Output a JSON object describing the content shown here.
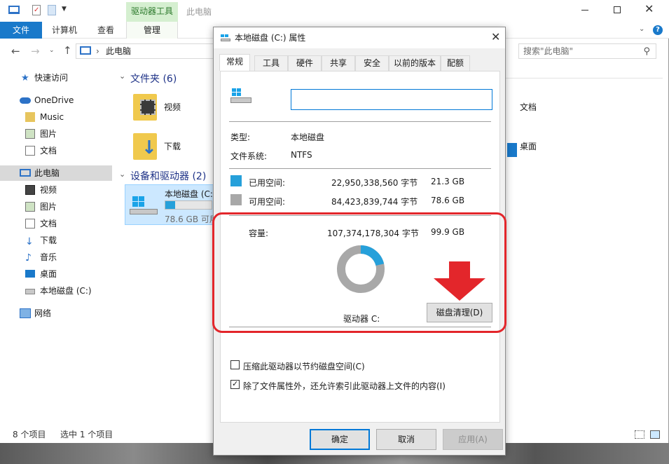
{
  "explorer": {
    "ribbon_tabs": [
      "文件",
      "计算机",
      "查看"
    ],
    "context_group": "驱动器工具",
    "context_tab": "管理",
    "window_title": "此电脑",
    "address": "此电脑",
    "search_placeholder": "搜索\"此电脑\"",
    "nav": {
      "quick_access": "快速访问",
      "onedrive": "OneDrive",
      "music": "Music",
      "pictures": "图片",
      "documents": "文档",
      "this_pc": "此电脑",
      "videos": "视频",
      "pictures2": "图片",
      "documents2": "文档",
      "downloads": "下载",
      "music2": "音乐",
      "desktop": "桌面",
      "local_disk": "本地磁盘 (C:)",
      "network": "网络"
    },
    "folders_header": "文件夹 (6)",
    "devices_header": "设备和驱动器 (2)",
    "folders": {
      "videos": "视频",
      "downloads": "下载",
      "documents": "文档",
      "desktop": "桌面"
    },
    "drive": {
      "name": "本地磁盘 (C:",
      "free": "78.6 GB 可用",
      "used_fraction": 0.213
    },
    "status": {
      "items": "8 个项目",
      "selected": "选中 1 个项目"
    }
  },
  "dialog": {
    "title": "本地磁盘 (C:) 属性",
    "tabs": [
      "常规",
      "工具",
      "硬件",
      "共享",
      "安全",
      "以前的版本",
      "配额"
    ],
    "name_value": "",
    "type_label": "类型:",
    "type_value": "本地磁盘",
    "fs_label": "文件系统:",
    "fs_value": "NTFS",
    "used_label": "已用空间:",
    "used_bytes": "22,950,338,560 字节",
    "used_gb": "21.3 GB",
    "free_label": "可用空间:",
    "free_bytes": "84,423,839,744 字节",
    "free_gb": "78.6 GB",
    "capacity_label": "容量:",
    "capacity_bytes": "107,374,178,304 字节",
    "capacity_gb": "99.9 GB",
    "drive_label": "驱动器 C:",
    "cleanup_button": "磁盘清理(D)",
    "compress_label": "压缩此驱动器以节约磁盘空间(C)",
    "compress_checked": false,
    "index_label": "除了文件属性外，还允许索引此驱动器上文件的内容(I)",
    "index_checked": true,
    "ok": "确定",
    "cancel": "取消",
    "apply": "应用(A)",
    "used_fraction": 0.213,
    "colors": {
      "used": "#26a0da",
      "free": "#a8a8a8",
      "highlight": "#e3262b"
    }
  }
}
